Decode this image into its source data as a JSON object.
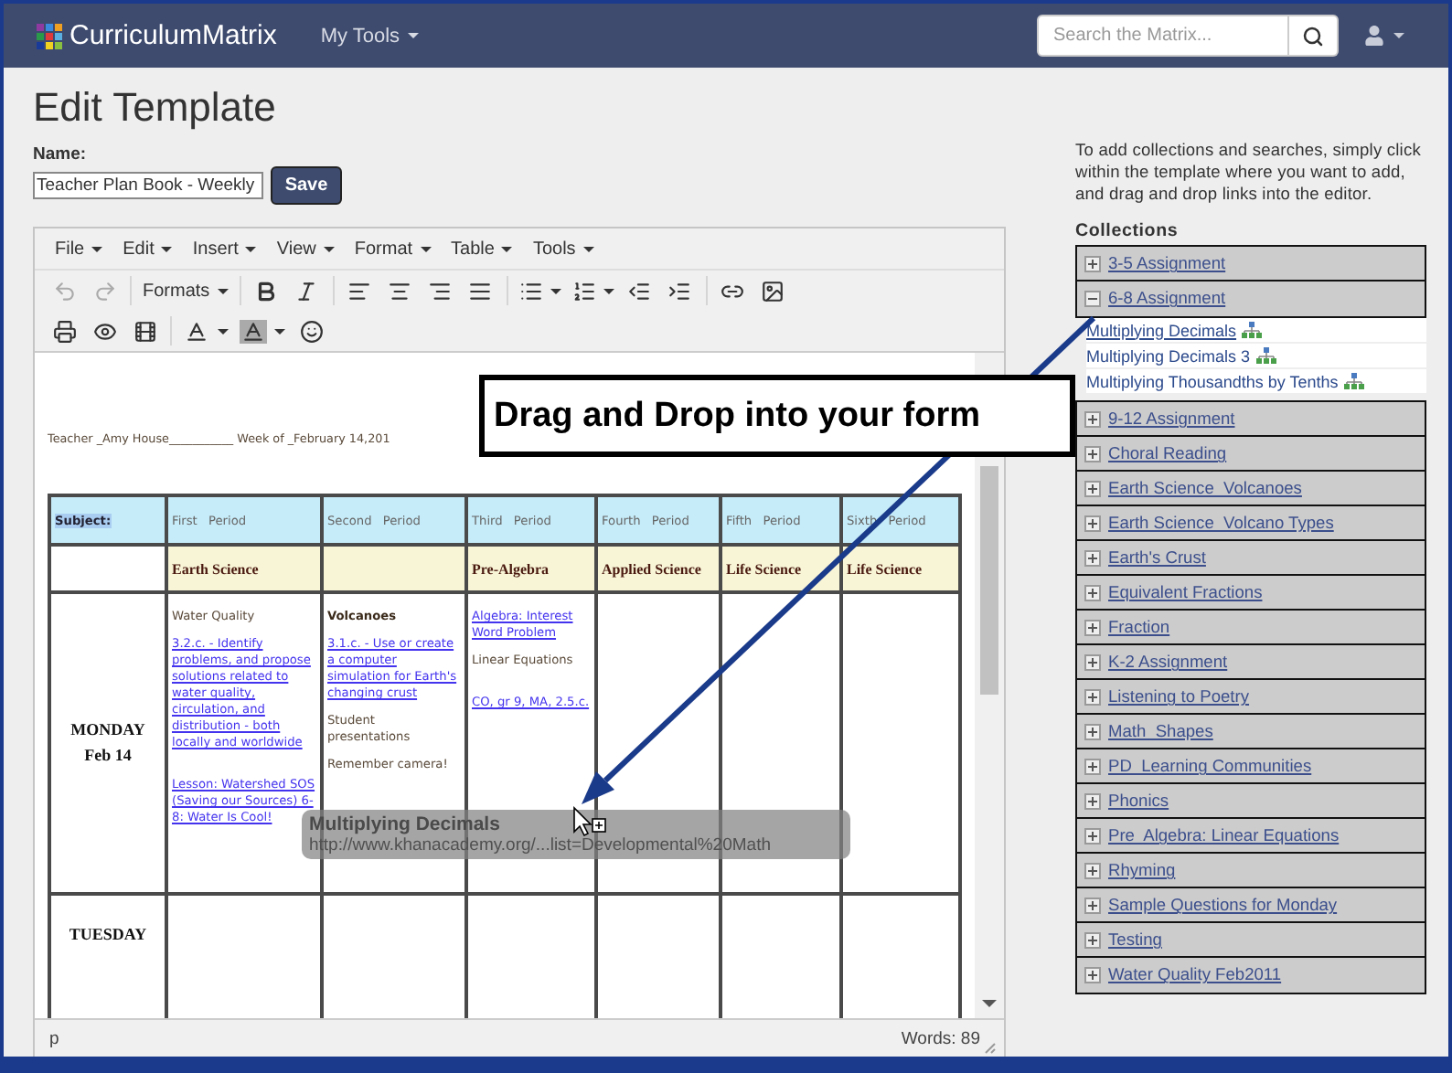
{
  "nav": {
    "brand": "CurriculumMatrix",
    "menu": "My Tools",
    "search_placeholder": "Search the Matrix..."
  },
  "page_title": "Edit Template",
  "name_field": {
    "label": "Name:",
    "value": "Teacher Plan Book - Weekly"
  },
  "save_button": "Save",
  "editor": {
    "menus": [
      "File",
      "Edit",
      "Insert",
      "View",
      "Format",
      "Table",
      "Tools"
    ],
    "undo_disabled": true,
    "redo_disabled": true,
    "formats": "Formats",
    "teacher_line": "Teacher _Amy House___________ Week of _February 14,201",
    "table": {
      "header": [
        {
          "text": "Subject:",
          "highlighted": true
        },
        {
          "text": "First Period",
          "highlighted": false
        },
        {
          "text": "Second Period",
          "highlighted": false
        },
        {
          "text": "Third Period",
          "highlighted": false
        },
        {
          "text": "Fourth Period",
          "highlighted": false
        },
        {
          "text": "Fifth Period",
          "highlighted": false
        },
        {
          "text": "Sixth Period",
          "highlighted": false
        }
      ],
      "subjects": {
        "period_1": "Earth Science",
        "period_3": "Pre-Algebra",
        "period_4": "Applied Science",
        "period_5": "Life Science",
        "period_6": "Life Science"
      },
      "rows": [
        {
          "day": "MONDAY",
          "date": "Feb 14",
          "cells": [
            [
              {
                "kind": "text",
                "text": "Water Quality"
              },
              {
                "kind": "link",
                "text": "3.2.c. - Identify problems, and propose solutions related to water quality, circulation, and distribution - both locally and worldwide"
              },
              {
                "kind": "link",
                "text": "Lesson: Watershed SOS (Saving our Sources) 6-8: Water Is Cool!"
              }
            ],
            [
              {
                "kind": "heading",
                "text": "Volcanoes"
              },
              {
                "kind": "link",
                "text": "3.1.c. - Use or create a computer simulation for Earth's changing crust"
              },
              {
                "kind": "text",
                "text": "Student presentations"
              },
              {
                "kind": "text",
                "text": "Remember camera!"
              }
            ],
            [
              {
                "kind": "link",
                "text": "Algebra: Interest Word Problem"
              },
              {
                "kind": "text",
                "text": "Linear Equations"
              },
              {
                "kind": "link",
                "text": "CO, gr 9, MA, 2.5.c."
              }
            ]
          ]
        },
        {
          "day": "TUESDAY"
        }
      ]
    },
    "status_path": "p",
    "word_count": "Words: 89"
  },
  "callout": "Drag and Drop into your form",
  "drag_preview": {
    "title": "Multiplying Decimals",
    "url": "http://www.khanacademy.org/...list=Developmental%20Math"
  },
  "sidebar": {
    "instructions": "To add collections and searches, simply click within the template where you want to add, and drag and drop links into the editor.",
    "heading": "Collections",
    "collections": [
      {
        "label": "3-5 Assignment",
        "expanded": false
      },
      {
        "label": "6-8 Assignment",
        "expanded": true,
        "children": [
          {
            "label": "Multiplying Decimals"
          },
          {
            "label": "Multiplying Decimals 3"
          },
          {
            "label": "Multiplying Thousandths by Tenths"
          }
        ]
      },
      {
        "label": "9-12 Assignment",
        "expanded": false
      },
      {
        "label": "Choral Reading",
        "expanded": false
      },
      {
        "label": "Earth Science  Volcanoes",
        "expanded": false
      },
      {
        "label": "Earth Science  Volcano Types",
        "expanded": false
      },
      {
        "label": "Earth's Crust",
        "expanded": false
      },
      {
        "label": "Equivalent Fractions",
        "expanded": false
      },
      {
        "label": "Fraction",
        "expanded": false
      },
      {
        "label": "K-2 Assignment",
        "expanded": false
      },
      {
        "label": "Listening to Poetry",
        "expanded": false
      },
      {
        "label": "Math  Shapes",
        "expanded": false
      },
      {
        "label": "PD  Learning Communities",
        "expanded": false
      },
      {
        "label": "Phonics",
        "expanded": false
      },
      {
        "label": "Pre  Algebra: Linear Equations",
        "expanded": false
      },
      {
        "label": "Rhyming",
        "expanded": false
      },
      {
        "label": "Sample Questions for Monday",
        "expanded": false
      },
      {
        "label": "Testing",
        "expanded": false
      },
      {
        "label": "Water Quality Feb2011",
        "expanded": false
      }
    ]
  }
}
